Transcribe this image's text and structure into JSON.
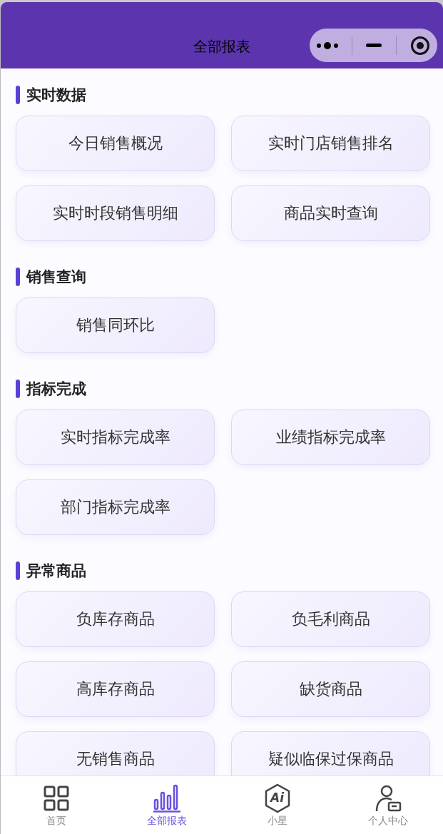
{
  "window": {
    "title": "全部报表"
  },
  "sections": [
    {
      "title": "实时数据",
      "items": [
        "今日销售概况",
        "实时门店销售排名",
        "实时时段销售明细",
        "商品实时查询"
      ]
    },
    {
      "title": "销售查询",
      "items": [
        "销售同环比"
      ]
    },
    {
      "title": "指标完成",
      "items": [
        "实时指标完成率",
        "业绩指标完成率",
        "部门指标完成率"
      ]
    },
    {
      "title": "异常商品",
      "items": [
        "负库存商品",
        "负毛利商品",
        "高库存商品",
        "缺货商品",
        "无销售商品",
        "疑似临保过保商品"
      ]
    }
  ],
  "tab_bar": [
    {
      "label": "首页",
      "kind": "grid",
      "selected": false
    },
    {
      "label": "全部报表",
      "kind": "bars",
      "selected": true
    },
    {
      "label": "小星",
      "kind": "ai",
      "icon_text": "Ai",
      "selected": false
    },
    {
      "label": "个人中心",
      "kind": "person",
      "selected": false
    }
  ]
}
